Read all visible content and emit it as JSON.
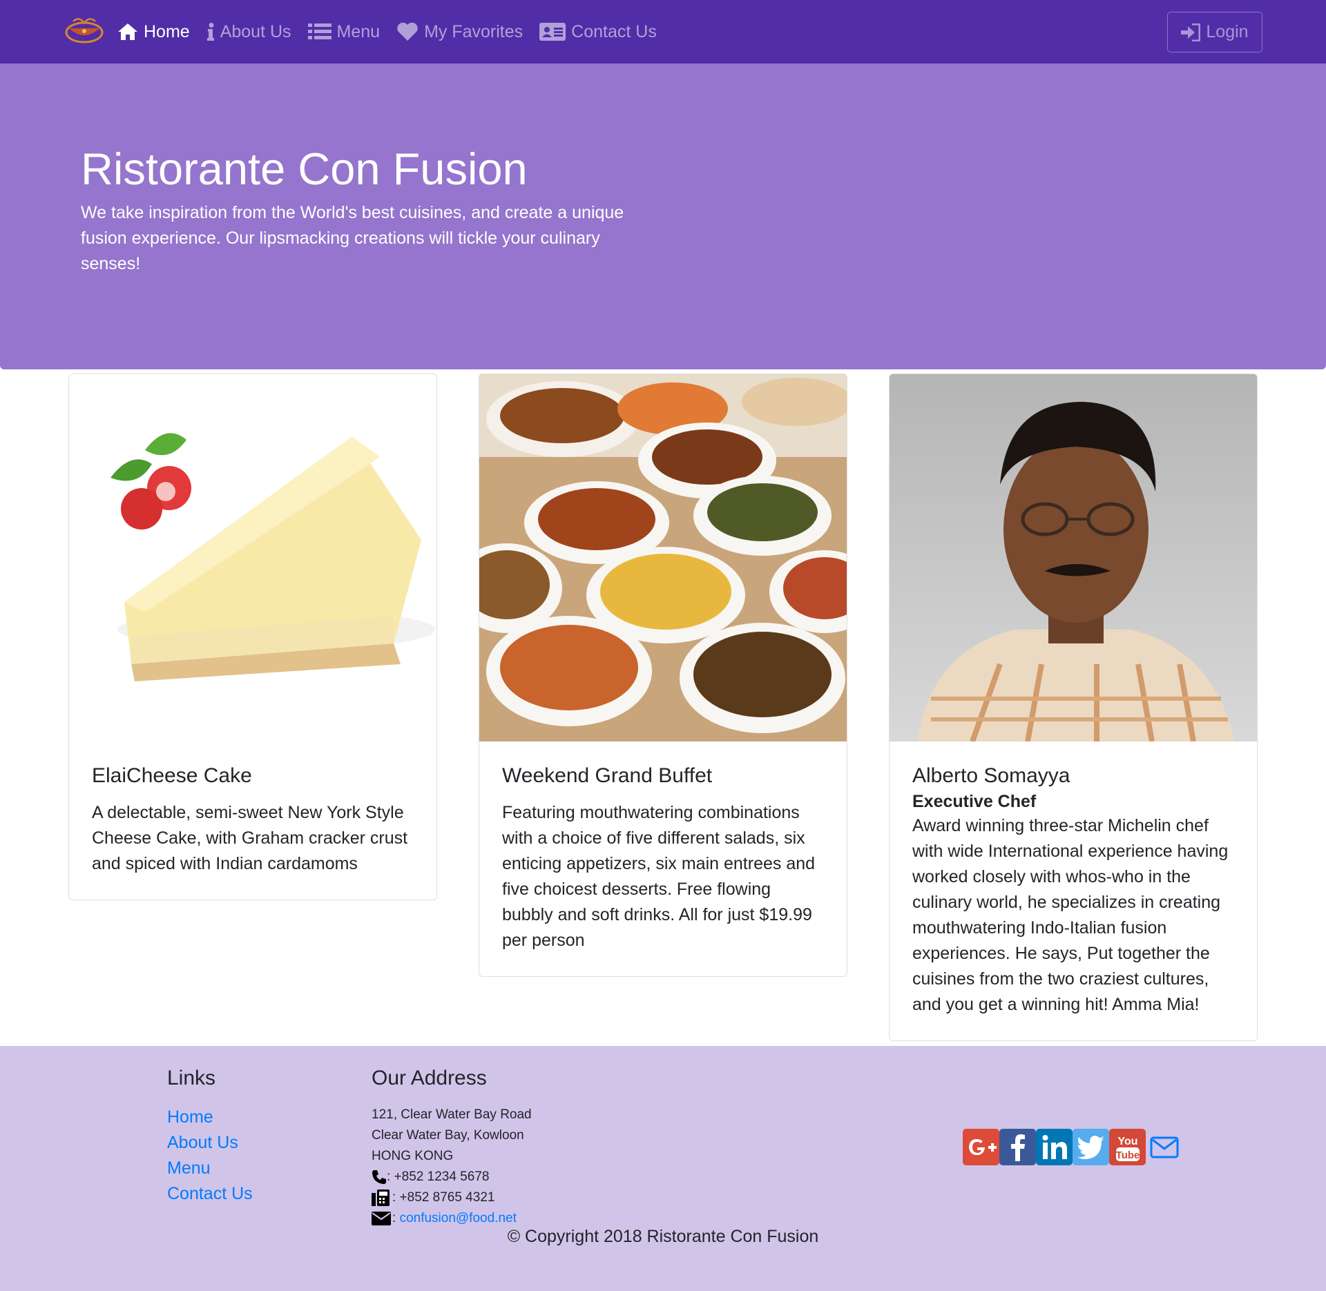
{
  "nav": {
    "items": [
      {
        "label": "Home",
        "icon": "home-icon",
        "active": true
      },
      {
        "label": "About Us",
        "icon": "info-icon",
        "active": false
      },
      {
        "label": "Menu",
        "icon": "list-icon",
        "active": false
      },
      {
        "label": "My Favorites",
        "icon": "heart-icon",
        "active": false
      },
      {
        "label": "Contact Us",
        "icon": "address-card-icon",
        "active": false
      }
    ],
    "login_label": "Login"
  },
  "hero": {
    "title": "Ristorante Con Fusion",
    "text": "We take inspiration from the World's best cuisines, and create a unique fusion experience. Our lipsmacking creations will tickle your culinary senses!"
  },
  "cards": [
    {
      "title": "ElaiCheese Cake",
      "subtitle": "",
      "text": "A delectable, semi-sweet New York Style Cheese Cake, with Graham cracker crust and spiced with Indian cardamoms"
    },
    {
      "title": "Weekend Grand Buffet",
      "subtitle": "",
      "text": "Featuring mouthwatering combinations with a choice of five different salads, six enticing appetizers, six main entrees and five choicest desserts. Free flowing bubbly and soft drinks. All for just $19.99 per person"
    },
    {
      "title": "Alberto Somayya",
      "subtitle": "Executive Chef",
      "text": "Award winning three-star Michelin chef with wide International experience having worked closely with whos-who in the culinary world, he specializes in creating mouthwatering Indo-Italian fusion experiences. He says, Put together the cuisines from the two craziest cultures, and you get a winning hit! Amma Mia!"
    }
  ],
  "footer": {
    "links_heading": "Links",
    "links": [
      "Home",
      "About Us",
      "Menu",
      "Contact Us"
    ],
    "address_heading": "Our Address",
    "address_lines": [
      "121, Clear Water Bay Road",
      "Clear Water Bay, Kowloon",
      "HONG KONG"
    ],
    "phone": ": +852 1234 5678",
    "fax": ": +852 8765 4321",
    "email": "confusion@food.net",
    "social": [
      "google-plus-icon",
      "facebook-icon",
      "linkedin-icon",
      "twitter-icon",
      "youtube-icon",
      "envelope-icon"
    ],
    "copyright": "© Copyright 2018 Ristorante Con Fusion"
  },
  "colors": {
    "primary_dark": "#512DA8",
    "primary": "#9575CD",
    "primary_light": "#D1C4E9",
    "link": "#007bff"
  }
}
